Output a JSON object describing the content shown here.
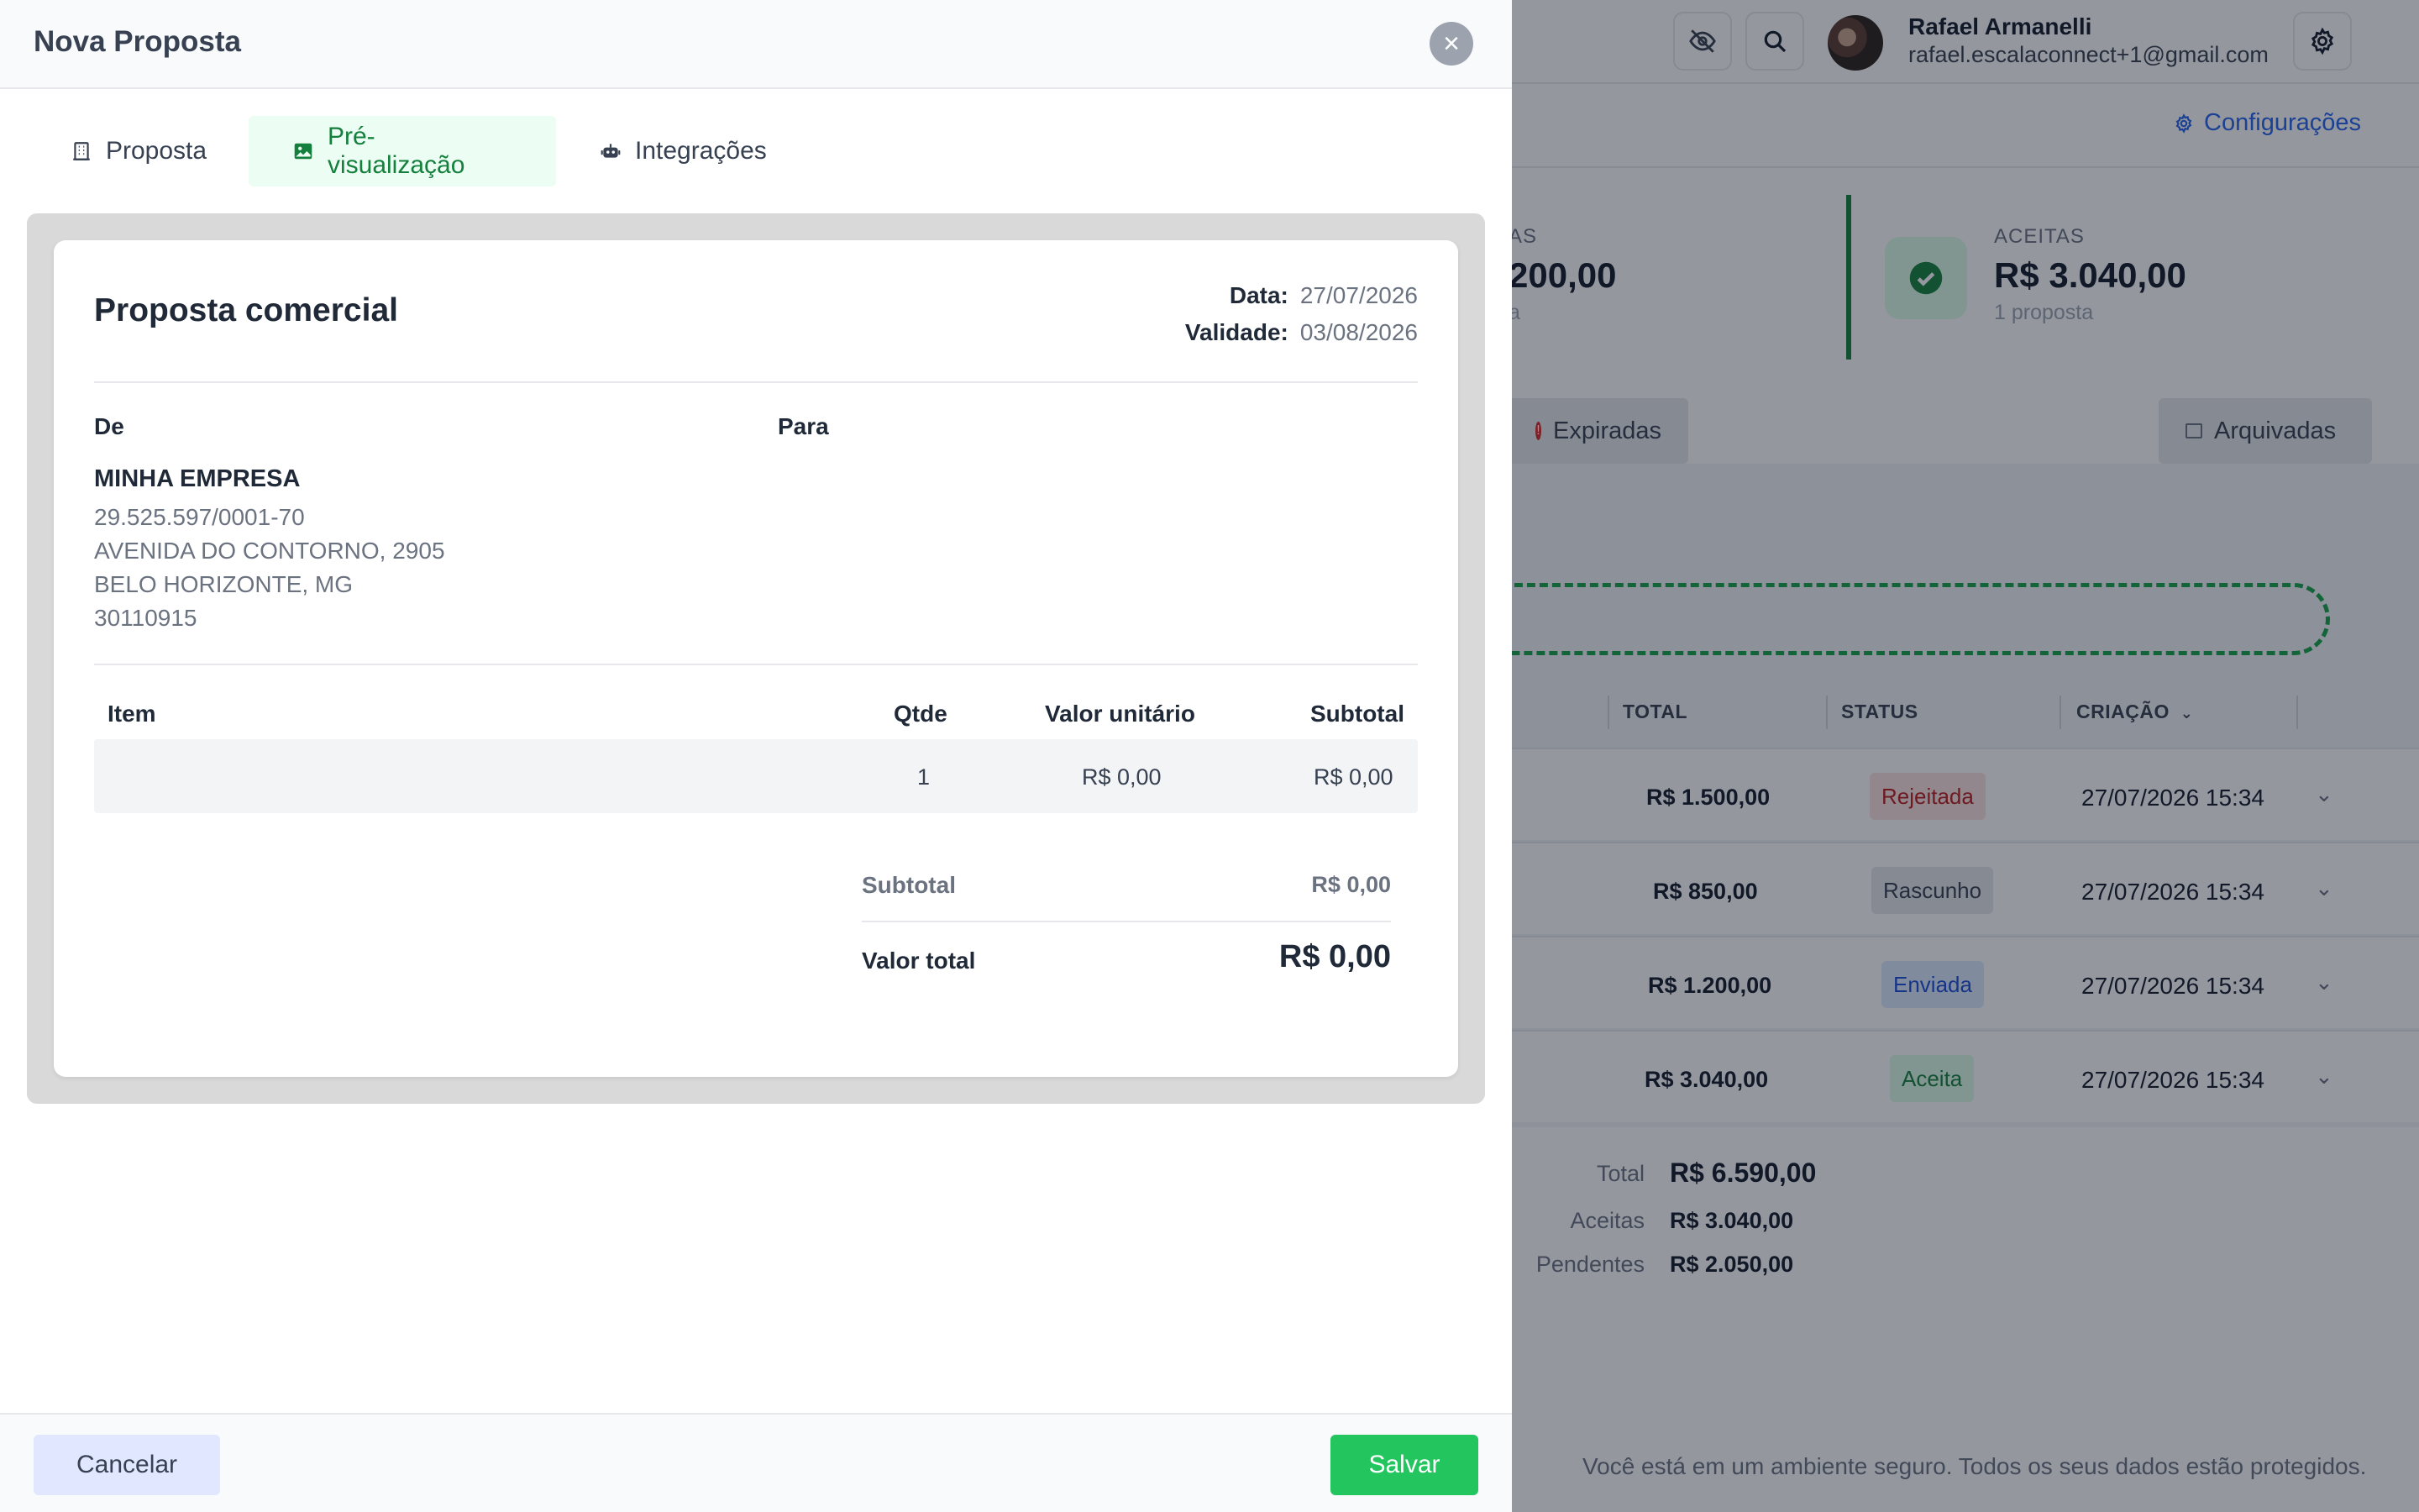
{
  "background": {
    "user": {
      "name": "Rafael Armanelli",
      "email": "rafael.escalaconnect+1@gmail.com"
    },
    "config_link": "Configurações",
    "stats": [
      {
        "label": "AS",
        "value": "200,00",
        "sub": "a"
      },
      {
        "label": "ACEITAS",
        "value": "R$ 3.040,00",
        "sub": "1 proposta"
      }
    ],
    "filter_tabs": {
      "expired": "Expiradas",
      "archived": "Arquivadas"
    },
    "table_headers": {
      "total": "TOTAL",
      "status": "STATUS",
      "created": "CRIAÇÃO"
    },
    "rows": [
      {
        "total": "R$ 1.500,00",
        "status": "Rejeitada",
        "date": "27/07/2026 15:34"
      },
      {
        "total": "R$ 850,00",
        "status": "Rascunho",
        "date": "27/07/2026 15:34"
      },
      {
        "total": "R$ 1.200,00",
        "status": "Enviada",
        "date": "27/07/2026 15:34"
      },
      {
        "total": "R$ 3.040,00",
        "status": "Aceita",
        "date": "27/07/2026 15:34"
      }
    ],
    "summary": [
      {
        "label": "Total",
        "value": "R$ 6.590,00"
      },
      {
        "label": "Aceitas",
        "value": "R$ 3.040,00"
      },
      {
        "label": "Pendentes",
        "value": "R$ 2.050,00"
      }
    ],
    "footer_note": "Você está em um ambiente seguro. Todos os seus dados estão protegidos."
  },
  "drawer": {
    "title": "Nova Proposta",
    "tabs": [
      {
        "label": "Proposta",
        "icon": "building-icon"
      },
      {
        "label": "Pré-visualização",
        "icon": "image-icon",
        "active": true
      },
      {
        "label": "Integrações",
        "icon": "robot-icon"
      }
    ],
    "document": {
      "title": "Proposta comercial",
      "date_label": "Data:",
      "date_value": "27/07/2026",
      "validity_label": "Validade:",
      "validity_value": "03/08/2026",
      "from_label": "De",
      "to_label": "Para",
      "company": {
        "name": "MINHA EMPRESA",
        "cnpj": "29.525.597/0001-70",
        "address": "AVENIDA DO CONTORNO, 2905",
        "city": "BELO HORIZONTE, MG",
        "zip": "30110915"
      },
      "columns": {
        "item": "Item",
        "qty": "Qtde",
        "unit_price": "Valor unitário",
        "subtotal": "Subtotal"
      },
      "items": [
        {
          "item": "",
          "qty": "1",
          "unit_price": "R$ 0,00",
          "subtotal": "R$ 0,00"
        }
      ],
      "subtotal_label": "Subtotal",
      "subtotal_value": "R$ 0,00",
      "total_label": "Valor total",
      "total_value": "R$ 0,00"
    },
    "footer": {
      "cancel": "Cancelar",
      "save": "Salvar"
    }
  },
  "colors": {
    "accent_green": "#22c55e",
    "active_tab_bg": "#ecfdf3",
    "active_tab_text": "#15803d",
    "link_blue": "#2563eb"
  }
}
